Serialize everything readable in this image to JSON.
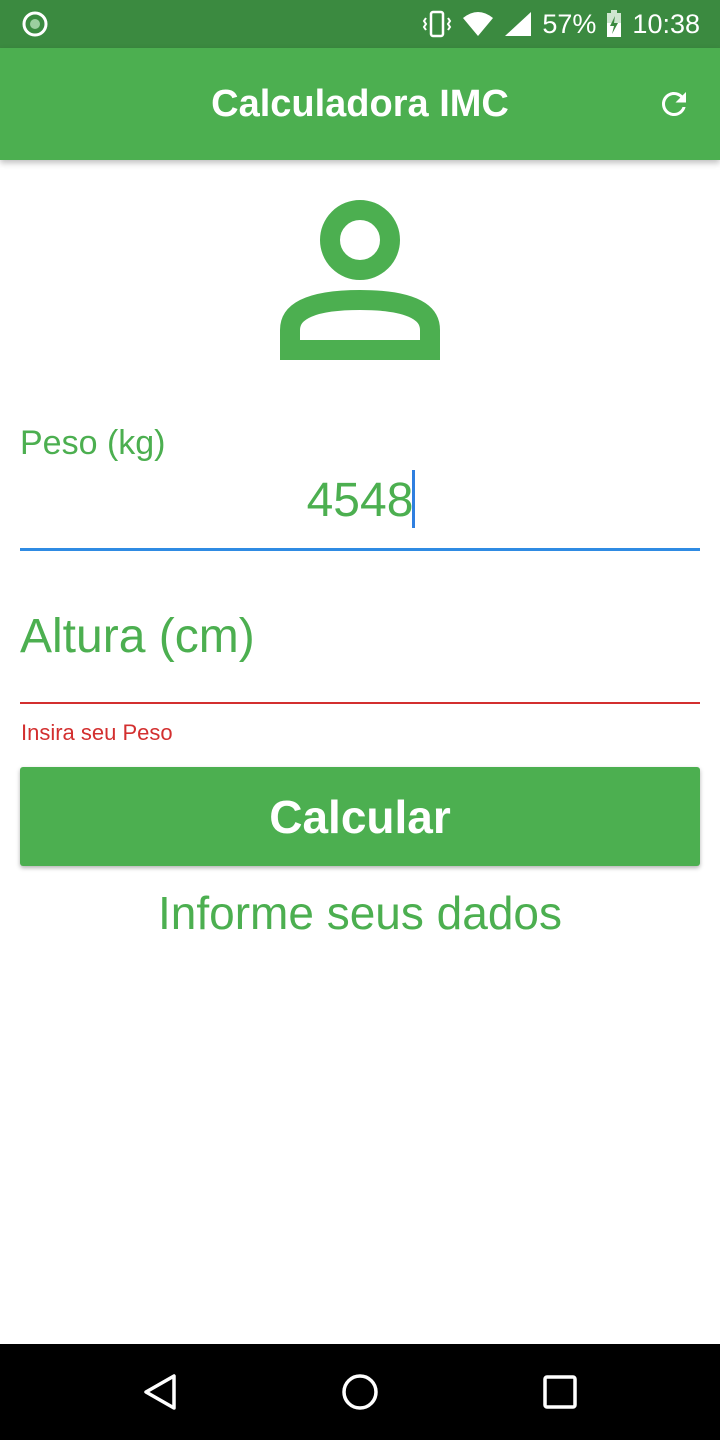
{
  "status_bar": {
    "battery_percent": "57%",
    "time": "10:38"
  },
  "app_bar": {
    "title": "Calculadora IMC",
    "refresh_icon": "refresh-icon"
  },
  "avatar_icon": "person-icon",
  "form": {
    "weight": {
      "label": "Peso (kg)",
      "value": "4548"
    },
    "height": {
      "placeholder": "Altura (cm)",
      "error": "Insira seu Peso"
    },
    "calculate_label": "Calcular",
    "info_text": "Informe seus dados"
  },
  "colors": {
    "primary": "#4caf50",
    "status_bar": "#3b8a40",
    "focus_underline": "#2f8be3",
    "error": "#d32f2f"
  },
  "nav_bar": {
    "icons": [
      "back-icon",
      "home-icon",
      "recents-icon"
    ]
  }
}
